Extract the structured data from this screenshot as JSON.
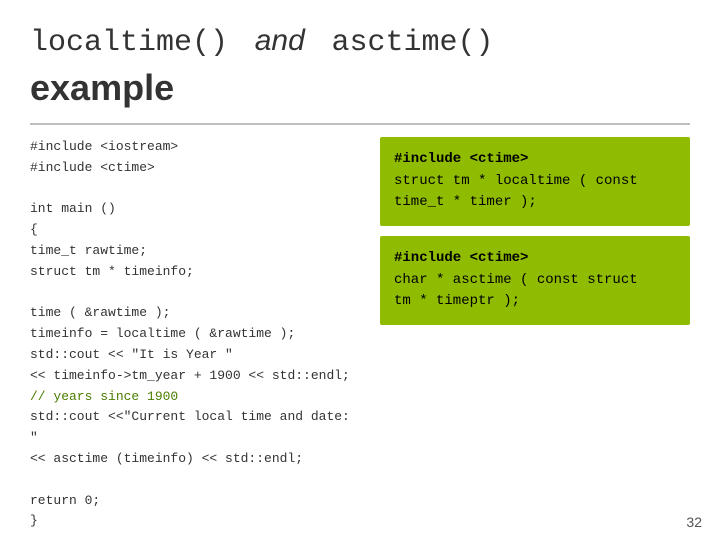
{
  "title": {
    "part1": "localtime()",
    "and": "and",
    "part2": "asctime()",
    "example": "example"
  },
  "left_code": {
    "line1": "#include <iostream>",
    "line2": "#include <ctime>",
    "line3": "",
    "line4": "int main ()",
    "line5": "{",
    "line6": "  time_t rawtime;",
    "line7": "  struct tm * timeinfo;",
    "line8": "",
    "line9": "  time ( &rawtime );",
    "line10": "  timeinfo = localtime ( &rawtime );",
    "line11": "  std::cout << \"It is Year \"",
    "line12": "            << timeinfo->tm_year + 1900 << std::endl;",
    "line13": "  // years since 1900",
    "line14": "  std::cout <<\"Current local time and date: \"",
    "line15": "  << asctime (timeinfo) << std::endl;",
    "line16": "",
    "line17": "  return 0;",
    "line18": "}"
  },
  "right_box1": {
    "line1": "#include <ctime>",
    "line2": "struct tm * localtime ( const",
    "line3": "time_t * timer );"
  },
  "right_box2": {
    "line1": "#include <ctime>",
    "line2": "char * asctime ( const struct",
    "line3": "tm * timeptr );"
  },
  "page_number": "32"
}
